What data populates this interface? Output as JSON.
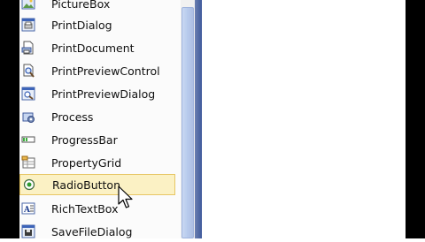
{
  "toolbox": {
    "items": [
      {
        "label": "PictureBox",
        "icon": "picturebox-icon"
      },
      {
        "label": "PrintDialog",
        "icon": "printdialog-icon"
      },
      {
        "label": "PrintDocument",
        "icon": "printdocument-icon"
      },
      {
        "label": "PrintPreviewControl",
        "icon": "printpreviewcontrol-icon"
      },
      {
        "label": "PrintPreviewDialog",
        "icon": "printpreviewdialog-icon"
      },
      {
        "label": "Process",
        "icon": "process-icon"
      },
      {
        "label": "ProgressBar",
        "icon": "progressbar-icon"
      },
      {
        "label": "PropertyGrid",
        "icon": "propertygrid-icon"
      },
      {
        "label": "RadioButton",
        "icon": "radiobutton-icon",
        "selected": true
      },
      {
        "label": "RichTextBox",
        "icon": "richtextbox-icon"
      },
      {
        "label": "SaveFileDialog",
        "icon": "savefiledialog-icon"
      }
    ]
  },
  "colors": {
    "selection_bg": "#fbf1c4",
    "selection_border": "#e7c664",
    "scrollbar": "#b7caec",
    "frame": "#4a64a6"
  }
}
